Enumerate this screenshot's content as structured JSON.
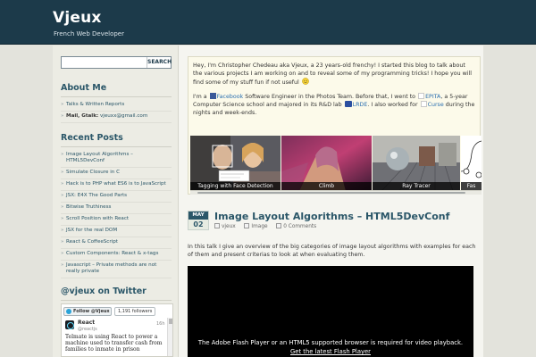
{
  "site": {
    "title": "Vjeux",
    "tagline": "French Web Developer"
  },
  "search": {
    "placeholder": "",
    "button_label": "SEARCH"
  },
  "sidebar": {
    "about": {
      "heading": "About Me",
      "items": [
        {
          "label": "Talks & Written Reports"
        },
        {
          "prefix": "Mail, Gtalk:",
          "label": "vjeuxx@gmail.com"
        }
      ]
    },
    "recent": {
      "heading": "Recent Posts",
      "items": [
        "Image Layout Algorithms – HTML5DevConf",
        "Simulate Closure in C",
        "Hack is to PHP what ES6 is to JavaScript",
        "JSX: E4X The Good Parts",
        "Bitwise Truthiness",
        "Scroll Position with React",
        "JSX for the real DOM",
        "React & CoffeeScript",
        "Custom Components: React & x-tags",
        "Javascript – Private methods are not really private"
      ]
    },
    "twitter": {
      "heading": "@vjeux on Twitter",
      "follow_label": "Follow @Vjeux",
      "followers": "1,191 followers",
      "tweet": {
        "name": "React",
        "handle": "@reactjs",
        "time": "16h",
        "text": "Telmate is using React to power a machine used to transfer cash from families to inmate in prison"
      }
    }
  },
  "intro": {
    "p1": "Hey, I'm Christopher Chedeau aka Vjeux, a 23 years-old frenchy! I started this blog to talk about the various projects I am working on and to reveal some of my programming tricks! I hope you will find some of my stuff fun if not useful",
    "p2": {
      "s1": "I'm a",
      "link_facebook": "Facebook",
      "s2": "Software Engineer in the Photos Team. Before that, I went to",
      "link_epita": "EPITA",
      "s3": ", a 5-year Computer Science school and majored in its R&D lab",
      "link_lrde": "LRDE",
      "s4": ". I also worked for",
      "link_curse": "Curse",
      "s5": "during the nights and week-ends."
    },
    "slides": [
      {
        "caption": "Tagging with Face Detection"
      },
      {
        "caption": "Climb"
      },
      {
        "caption": "Ray Tracer"
      },
      {
        "caption": "Fas"
      }
    ]
  },
  "post": {
    "month": "MAY",
    "day": "02",
    "title": "Image Layout Algorithms – HTML5DevConf",
    "author": "vjeux",
    "category": "Image",
    "comments": "0 Comments",
    "excerpt": "In this talk I give an overview of the big categories of image layout algorithms with examples for each of them and present criterias to look at when evaluating them.",
    "video_msg": "The Adobe Flash Player or an HTML5 supported browser is required for video playback.",
    "video_link": "Get the latest Flash Player"
  }
}
